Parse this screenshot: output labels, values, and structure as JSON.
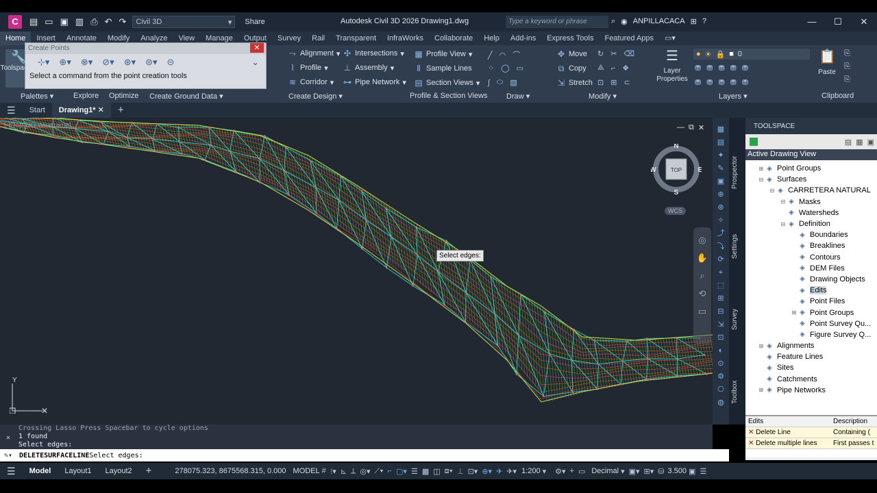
{
  "app": {
    "logo": "C",
    "title": "Autodesk Civil 3D 2026   Drawing1.dwg",
    "workspace": "Civil 3D",
    "share": "Share",
    "search_placeholder": "Type a keyword or phrase",
    "user": "ANPILLACACA"
  },
  "ribbon_tabs": [
    "Home",
    "Insert",
    "Annotate",
    "Modify",
    "Analyze",
    "View",
    "Manage",
    "Output",
    "Survey",
    "Rail",
    "Transparent",
    "InfraWorks",
    "Collaborate",
    "Help",
    "Add-ins",
    "Express Tools",
    "Featured Apps"
  ],
  "ribbon": {
    "tools_label": "Toolspace",
    "create_design": {
      "alignment": "Alignment",
      "profile": "Profile",
      "corridor": "Corridor",
      "intersections": "Intersections",
      "assembly": "Assembly",
      "pipe_network": "Pipe Network"
    },
    "profile_section": {
      "profile_view": "Profile View",
      "sample_lines": "Sample Lines",
      "section_views": "Section Views"
    },
    "modify": {
      "move": "Move",
      "copy": "Copy",
      "stretch": "Stretch"
    },
    "layers": {
      "layer_properties": "Layer Properties",
      "current_layer": "0"
    },
    "clipboard": {
      "paste": "Paste"
    },
    "panels": {
      "palettes": "Palettes",
      "explore": "Explore",
      "optimize": "Optimize",
      "create_ground_data": "Create Ground Data",
      "create_design": "Create Design",
      "profile_section_views": "Profile & Section Views",
      "draw": "Draw",
      "modify": "Modify",
      "layers": "Layers",
      "clipboard": "Clipboard"
    }
  },
  "create_points": {
    "title": "Create Points",
    "message": "Select a command from the point creation tools"
  },
  "file_tabs": {
    "start": "Start",
    "drawing": "Drawing1*"
  },
  "viewport": {
    "label": "[-][Top][2D Wireframe]",
    "tooltip": "Select edges:",
    "viewcube": {
      "n": "N",
      "s": "S",
      "e": "E",
      "w": "W",
      "top": "TOP",
      "wcs": "WCS"
    },
    "ucs_y": "Y"
  },
  "toolspace": {
    "title": "TOOLSPACE",
    "view": "Active Drawing View",
    "side_tabs": [
      "Prospector",
      "Settings",
      "Survey",
      "Toolbox"
    ],
    "tree": [
      {
        "label": "Point Groups",
        "level": 1,
        "exp": "+",
        "icon": "point-groups"
      },
      {
        "label": "Surfaces",
        "level": 1,
        "exp": "−",
        "icon": "surfaces"
      },
      {
        "label": "CARRETERA NATURAL",
        "level": 2,
        "exp": "−",
        "icon": "surface"
      },
      {
        "label": "Masks",
        "level": 3,
        "exp": "−",
        "icon": "masks"
      },
      {
        "label": "Watersheds",
        "level": 3,
        "exp": "",
        "icon": "watersheds"
      },
      {
        "label": "Definition",
        "level": 3,
        "exp": "−",
        "icon": "definition"
      },
      {
        "label": "Boundaries",
        "level": 4,
        "exp": "",
        "icon": "boundaries"
      },
      {
        "label": "Breaklines",
        "level": 4,
        "exp": "",
        "icon": "breaklines"
      },
      {
        "label": "Contours",
        "level": 4,
        "exp": "",
        "icon": "contours"
      },
      {
        "label": "DEM Files",
        "level": 4,
        "exp": "",
        "icon": "dem"
      },
      {
        "label": "Drawing Objects",
        "level": 4,
        "exp": "",
        "icon": "drawing-objects"
      },
      {
        "label": "Edits",
        "level": 4,
        "exp": "",
        "icon": "edits",
        "selected": true
      },
      {
        "label": "Point Files",
        "level": 4,
        "exp": "",
        "icon": "point-files"
      },
      {
        "label": "Point Groups",
        "level": 4,
        "exp": "+",
        "icon": "point-groups"
      },
      {
        "label": "Point Survey Qu...",
        "level": 4,
        "exp": "",
        "icon": "survey-query"
      },
      {
        "label": "Figure Survey Q...",
        "level": 4,
        "exp": "",
        "icon": "survey-query"
      },
      {
        "label": "Alignments",
        "level": 1,
        "exp": "+",
        "icon": "alignments"
      },
      {
        "label": "Feature Lines",
        "level": 1,
        "exp": "",
        "icon": "feature-lines"
      },
      {
        "label": "Sites",
        "level": 1,
        "exp": "",
        "icon": "sites"
      },
      {
        "label": "Catchments",
        "level": 1,
        "exp": "",
        "icon": "catchments"
      },
      {
        "label": "Pipe Networks",
        "level": 1,
        "exp": "+",
        "icon": "pipe-networks"
      }
    ],
    "edits_grid": {
      "headers": [
        "Edits",
        "Description"
      ],
      "rows": [
        [
          "Delete Line",
          "Containing ("
        ],
        [
          "Delete multiple lines",
          "First passes t"
        ]
      ]
    }
  },
  "command": {
    "history": [
      "Crossing Lasso  Press Spacebar to cycle options",
      "1 found",
      "Select edges:"
    ],
    "prompt_cmd": "DELETESURFACELINE",
    "prompt_text": " Select edges:"
  },
  "status": {
    "tabs": [
      "Model",
      "Layout1",
      "Layout2"
    ],
    "coords": "278075.323, 8675568.315, 0.000",
    "model": "MODEL",
    "scale": "1:200",
    "units": "Decimal",
    "elevation": "3.500"
  },
  "colors": {
    "tin": "#2fe0c8",
    "contour": "#e04a2c",
    "surface": "#c9e04e",
    "canvas": "#222832"
  }
}
